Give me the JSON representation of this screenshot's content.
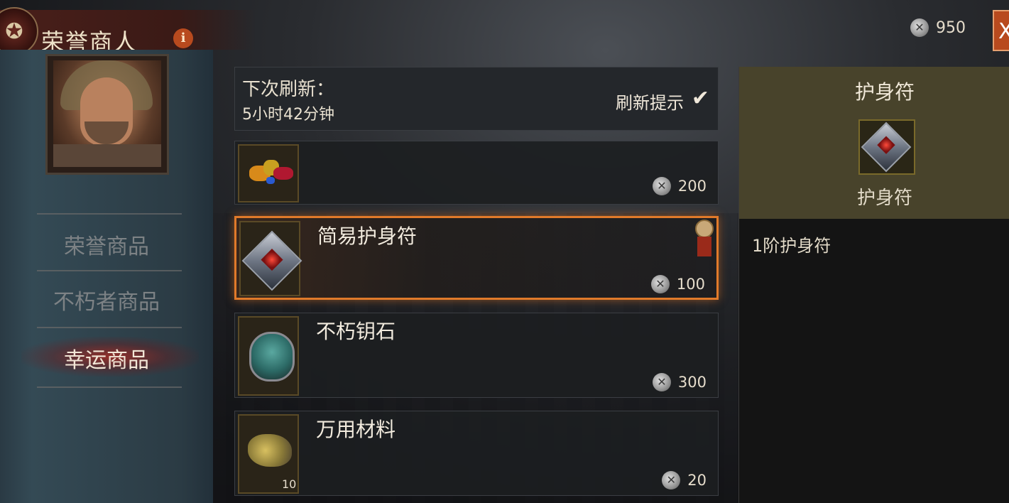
{
  "header": {
    "title": "荣誉商人",
    "info_icon_label": "i",
    "currency_amount": "950",
    "close_label": "X"
  },
  "sidebar": {
    "nav": [
      {
        "label": "荣誉商品",
        "active": false
      },
      {
        "label": "不朽者商品",
        "active": false
      },
      {
        "label": "幸运商品",
        "active": true
      }
    ]
  },
  "refresh": {
    "label": "下次刷新：",
    "time": "5小时42分钟",
    "tip_label": "刷新提示",
    "tip_checked": true
  },
  "items": [
    {
      "name": "",
      "price": "200",
      "icon": "gems-icon"
    },
    {
      "name": "简易护身符",
      "price": "100",
      "icon": "amulet-icon",
      "selected": true
    },
    {
      "name": "不朽钥石",
      "price": "300",
      "icon": "mask-key-icon"
    },
    {
      "name": "万用材料",
      "price": "20",
      "icon": "material-icon",
      "quantity": "10"
    }
  ],
  "detail": {
    "category": "护身符",
    "name": "护身符",
    "description": "1阶护身符"
  },
  "colors": {
    "accent": "#e07a2a",
    "active_nav_glow": "#b4281e",
    "detail_header": "#48432b"
  }
}
